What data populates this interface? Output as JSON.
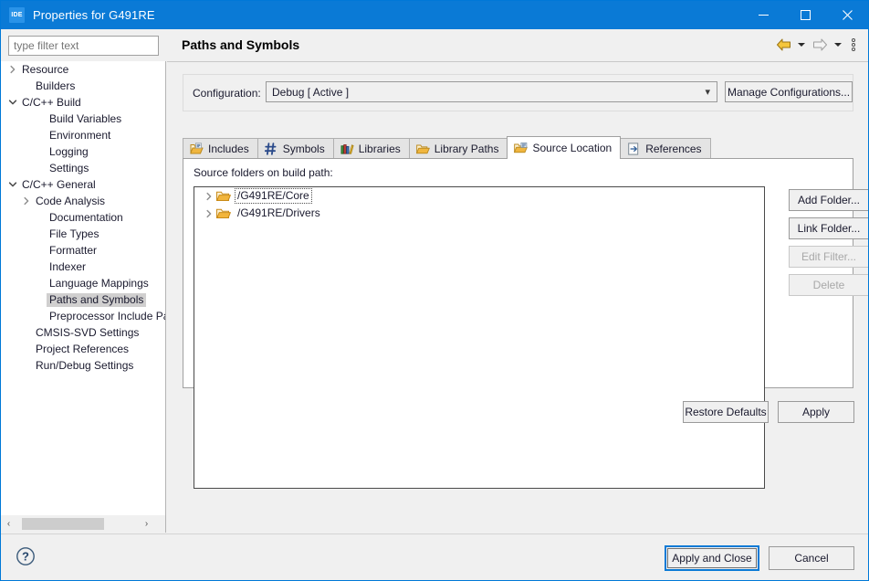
{
  "window": {
    "title": "Properties for G491RE",
    "app_icon_label": "IDE",
    "titlebar_color": "#0a7ad6",
    "controls": {
      "minimize": "minimize-button",
      "maximize": "maximize-button",
      "close": "close-button"
    }
  },
  "sidebar": {
    "filter": {
      "value": "",
      "placeholder": "type filter text"
    },
    "items": [
      {
        "label": "Resource",
        "indent": 0,
        "twisty": "collapsed",
        "selected": false
      },
      {
        "label": "Builders",
        "indent": 1,
        "twisty": "none",
        "selected": false
      },
      {
        "label": "C/C++ Build",
        "indent": 0,
        "twisty": "expanded",
        "selected": false
      },
      {
        "label": "Build Variables",
        "indent": 2,
        "twisty": "none",
        "selected": false
      },
      {
        "label": "Environment",
        "indent": 2,
        "twisty": "none",
        "selected": false
      },
      {
        "label": "Logging",
        "indent": 2,
        "twisty": "none",
        "selected": false
      },
      {
        "label": "Settings",
        "indent": 2,
        "twisty": "none",
        "selected": false
      },
      {
        "label": "C/C++ General",
        "indent": 0,
        "twisty": "expanded",
        "selected": false
      },
      {
        "label": "Code Analysis",
        "indent": 1,
        "twisty": "collapsed",
        "selected": false
      },
      {
        "label": "Documentation",
        "indent": 2,
        "twisty": "none",
        "selected": false
      },
      {
        "label": "File Types",
        "indent": 2,
        "twisty": "none",
        "selected": false
      },
      {
        "label": "Formatter",
        "indent": 2,
        "twisty": "none",
        "selected": false
      },
      {
        "label": "Indexer",
        "indent": 2,
        "twisty": "none",
        "selected": false
      },
      {
        "label": "Language Mappings",
        "indent": 2,
        "twisty": "none",
        "selected": false
      },
      {
        "label": "Paths and Symbols",
        "indent": 2,
        "twisty": "none",
        "selected": true
      },
      {
        "label": "Preprocessor Include Pat",
        "indent": 2,
        "twisty": "none",
        "selected": false
      },
      {
        "label": "CMSIS-SVD Settings",
        "indent": 1,
        "twisty": "none",
        "selected": false
      },
      {
        "label": "Project References",
        "indent": 1,
        "twisty": "none",
        "selected": false
      },
      {
        "label": "Run/Debug Settings",
        "indent": 1,
        "twisty": "none",
        "selected": false
      }
    ],
    "scrollbar": {
      "left_arrow": "‹",
      "right_arrow": "›"
    }
  },
  "page": {
    "title": "Paths and Symbols",
    "toolbar": {
      "back_icon": "back-arrow-icon",
      "back_enabled": true,
      "forward_icon": "forward-arrow-icon",
      "forward_enabled": false,
      "menu_icon": "view-menu-icon"
    }
  },
  "configuration": {
    "label": "Configuration:",
    "selected": "Debug  [ Active ]",
    "options": [
      "Debug  [ Active ]"
    ],
    "manage_button": "Manage Configurations..."
  },
  "tabs": [
    {
      "label": "Includes",
      "icon": "includes-icon",
      "active": false
    },
    {
      "label": "Symbols",
      "icon": "symbols-hash-icon",
      "active": false
    },
    {
      "label": "Libraries",
      "icon": "libraries-icon",
      "active": false
    },
    {
      "label": "Library Paths",
      "icon": "library-paths-icon",
      "active": false
    },
    {
      "label": "Source Location",
      "icon": "source-location-icon",
      "active": true
    },
    {
      "label": "References",
      "icon": "references-icon",
      "active": false
    }
  ],
  "source_location": {
    "list_label": "Source folders on build path:",
    "folders": [
      {
        "path": "/G491RE/Core",
        "twisty": "collapsed",
        "focused": true
      },
      {
        "path": "/G491RE/Drivers",
        "twisty": "collapsed",
        "focused": false
      }
    ],
    "buttons": [
      {
        "label": "Add Folder...",
        "enabled": true
      },
      {
        "label": "Link Folder...",
        "enabled": true
      },
      {
        "label": "Edit Filter...",
        "enabled": false
      },
      {
        "label": "Delete",
        "enabled": false
      }
    ]
  },
  "actions": {
    "restore_defaults": "Restore Defaults",
    "apply": "Apply",
    "apply_and_close": "Apply and Close",
    "cancel": "Cancel",
    "help_icon": "help-question-icon"
  },
  "colors": {
    "accent": "#0a7ad6",
    "chrome": "#f0f0f0",
    "selection": "#d0cfcf",
    "folder": "#e8a33d"
  }
}
